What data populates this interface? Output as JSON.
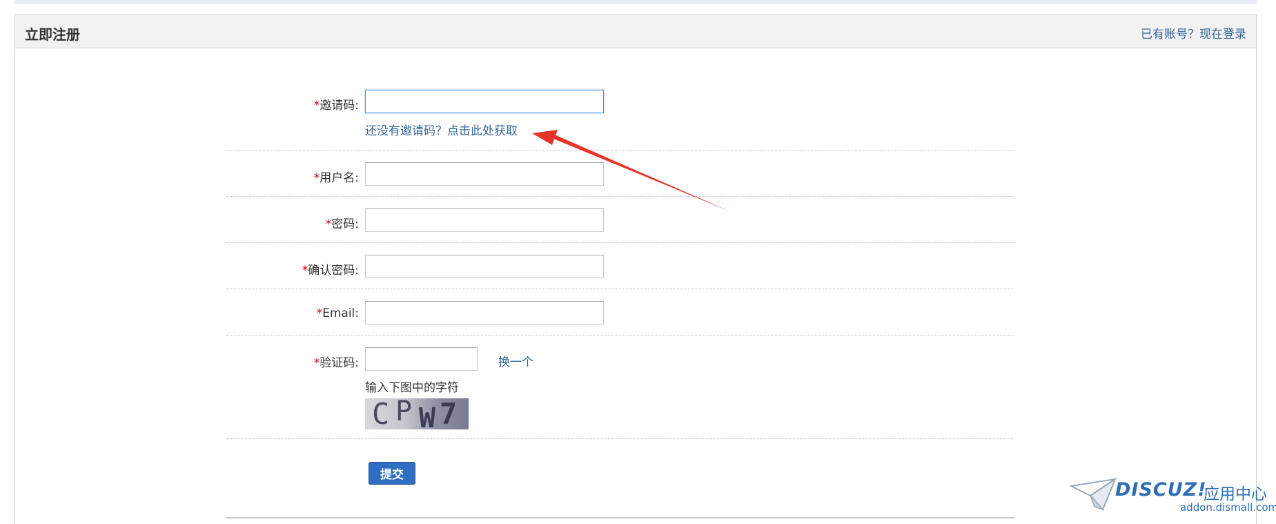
{
  "page": {
    "title": "立即注册",
    "login_link": "已有账号？现在登录"
  },
  "form": {
    "invite": {
      "required": "*",
      "label": "邀请码:",
      "value": "",
      "hint": "还没有邀请码？点击此处获取"
    },
    "username": {
      "required": "*",
      "label": "用户名:",
      "value": ""
    },
    "password": {
      "required": "*",
      "label": "密码:",
      "value": ""
    },
    "confirm_password": {
      "required": "*",
      "label": "确认密码:",
      "value": ""
    },
    "email": {
      "required": "*",
      "label": "Email:",
      "value": ""
    },
    "captcha": {
      "required": "*",
      "label": "验证码:",
      "value": "",
      "change_link": "换一个",
      "tip": "输入下图中的字符",
      "image_chars": [
        "C",
        "P",
        "W",
        "7"
      ]
    },
    "submit_label": "提交"
  },
  "brand": {
    "name": "DISCUZ!",
    "name_cn": "应用中心",
    "url": "addon.dismall.com"
  },
  "colors": {
    "link": "#336699",
    "required": "#cc0000",
    "submit": "#2f6ec1",
    "arrow": "#e8332a",
    "brand": "#2e6db4"
  }
}
